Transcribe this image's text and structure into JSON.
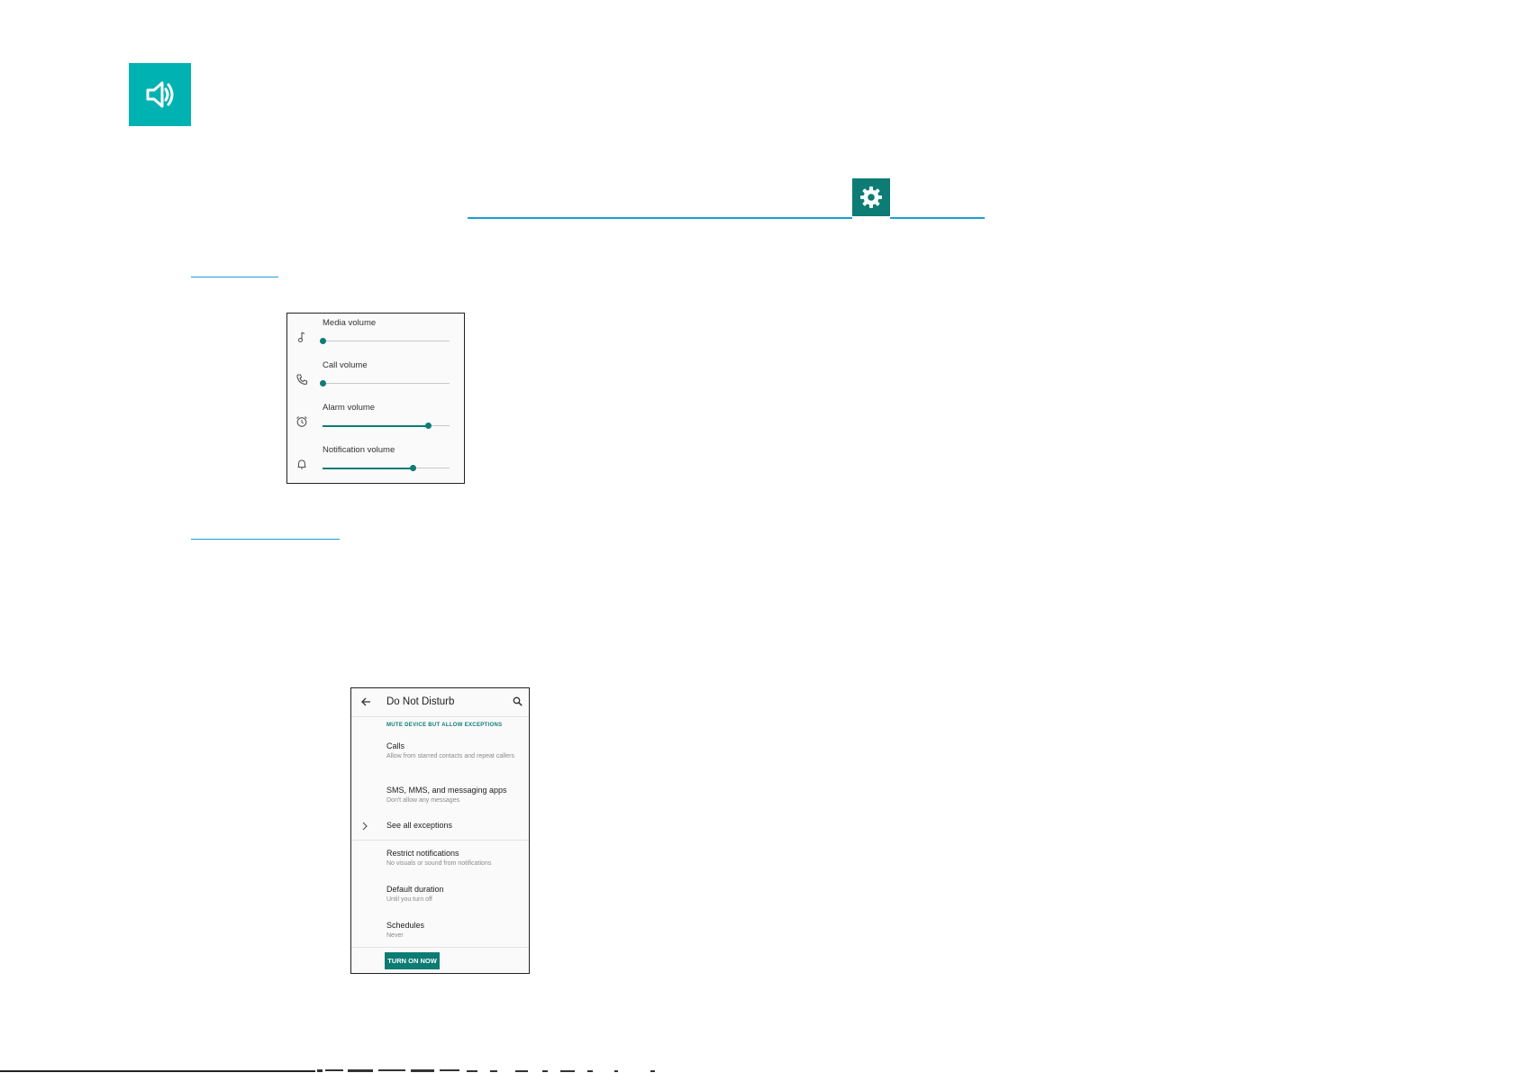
{
  "header": {
    "sound_icon": "volume-up-icon",
    "settings_icon": "gear-icon",
    "accent_color": "#00b2b2",
    "settings_color": "#0d7c74",
    "link_color": "#1a9fd6"
  },
  "volume_panel": {
    "items": [
      {
        "label": "Media volume",
        "icon": "music-note-icon",
        "level": 0.0
      },
      {
        "label": "Call volume",
        "icon": "phone-icon",
        "level": 0.0
      },
      {
        "label": "Alarm volume",
        "icon": "alarm-icon",
        "level": 0.83
      },
      {
        "label": "Notification volume",
        "icon": "bell-icon",
        "level": 0.71
      }
    ],
    "slider_color": "#0d7c74"
  },
  "dnd_panel": {
    "title": "Do Not Disturb",
    "section": "MUTE DEVICE BUT ALLOW EXCEPTIONS",
    "items": [
      {
        "title": "Calls",
        "subtitle": "Allow from starred contacts and repeat callers"
      },
      {
        "title": "SMS, MMS, and messaging apps",
        "subtitle": "Don't allow any messages"
      },
      {
        "title": "See all exceptions",
        "subtitle": ""
      },
      {
        "title": "Restrict notifications",
        "subtitle": "No visuals or sound from notifications"
      },
      {
        "title": "Default duration",
        "subtitle": "Until you turn off"
      },
      {
        "title": "Schedules",
        "subtitle": "Never"
      }
    ],
    "button_label": "TURN ON NOW"
  }
}
